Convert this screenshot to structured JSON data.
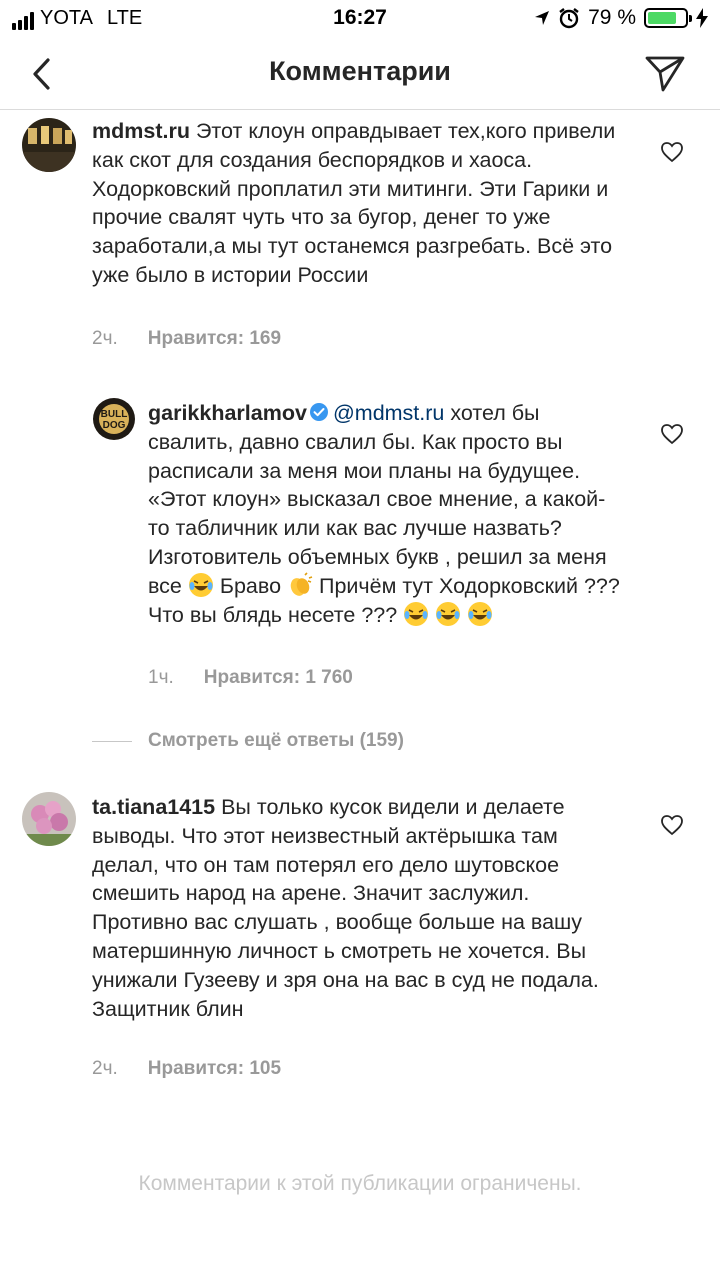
{
  "status_bar": {
    "carrier": "YOTA",
    "network": "LTE",
    "time": "16:27",
    "battery": "79 %",
    "battery_level": 0.79,
    "icons": [
      "signal-icon",
      "location-arrow-icon",
      "alarm-icon",
      "battery-icon",
      "charging-bolt-icon"
    ]
  },
  "nav": {
    "title": "Комментарии",
    "back_icon": "chevron-left-icon",
    "share_icon": "direct-send-icon"
  },
  "comments": [
    {
      "username": "mdmst.ru",
      "text": "Этот клоун оправдывает тех,кого привели как скот для создания беспорядков и хаоса. Ходорковский проплатил эти митинги. Эти Гарики и прочие свалят чуть что за бугор, денег то уже заработали,а мы тут останемся разгребать. Всё это уже было в истории России",
      "time": "2ч.",
      "likes": "Нравится: 169"
    },
    {
      "username": "garikkharlamov",
      "verified": true,
      "mention": "@mdmst.ru",
      "text_part1": "хотел бы свалить, давно свалил бы. Как просто вы расписали за меня мои планы на будущее. «Этот клоун» высказал свое мнение, а какой-то табличник или как вас лучше назвать? Изготовитель объемных букв , решил за меня все",
      "text_part2": "Браво",
      "text_part3": "Причём тут Ходорковский ??? Что вы блядь несете ???",
      "time": "1ч.",
      "likes": "Нравится: 1 760"
    },
    {
      "username": "ta.tiana1415",
      "text": "Вы только кусок видели и делаете выводы. Что этот неизвестный актёрышка там делал, что он там потерял его дело шутовское смешить народ на арене. Значит заслужил. Противно вас слушать , вообще больше на вашу матершинную личност  ь смотреть не хочется. Вы унижали Гузееву и зря она на вас в суд не подала. Защитник блин",
      "time": "2ч.",
      "likes": "Нравится: 105"
    }
  ],
  "more_replies": "Смотреть ещё ответы (159)",
  "footer": "Комментарии к этой публикации ограничены.",
  "colors": {
    "text": "#262626",
    "meta": "#999999",
    "mention": "#003569",
    "verified": "#3897f0",
    "battery": "#4cd964"
  }
}
